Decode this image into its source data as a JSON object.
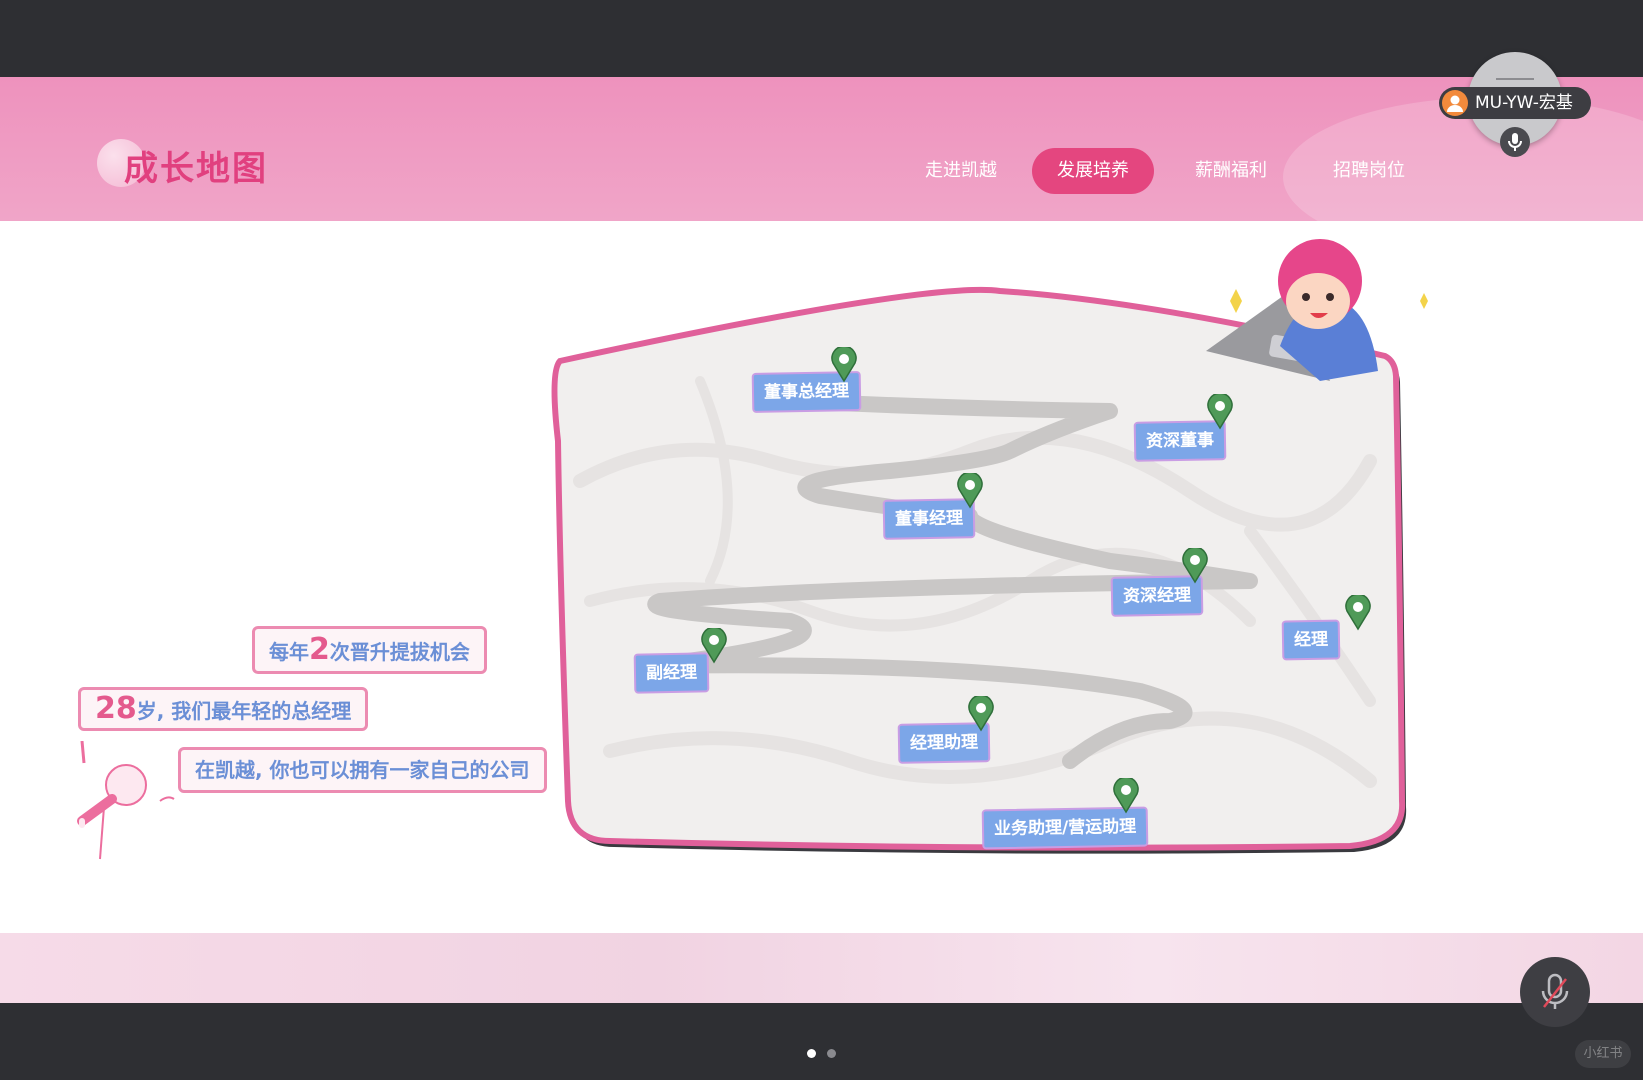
{
  "header": {
    "title": "成长地图",
    "nav": [
      {
        "label": "走进凯越",
        "active": false
      },
      {
        "label": "发展培养",
        "active": true
      },
      {
        "label": "薪酬福利",
        "active": false
      },
      {
        "label": "招聘岗位",
        "active": false
      }
    ],
    "user": "MU-YW-宏基"
  },
  "bubbles": {
    "b1": {
      "pre": "每年",
      "num": "2",
      "post": "次晋升提拔机会"
    },
    "b2": {
      "num": "28",
      "post": "岁, 我们最年轻的总经理"
    },
    "b3": {
      "text": "在凯越, 你也可以拥有一家自己的公司"
    }
  },
  "map_labels": [
    "董事总经理",
    "资深董事",
    "董事经理",
    "资深经理",
    "经理",
    "副经理",
    "经理助理",
    "业务助理/营运助理"
  ],
  "colors": {
    "accent": "#e4467f",
    "header_pink": "#ee92bd",
    "label_blue": "#7ca6e8",
    "pin_green": "#4f9a58"
  },
  "pagination": {
    "count": 2,
    "active": 0
  },
  "watermark": "小红书",
  "icons": [
    "user-avatar-icon",
    "microphone-icon",
    "microphone-muted-icon",
    "map-pin-icon",
    "speaker-microphone-icon"
  ]
}
